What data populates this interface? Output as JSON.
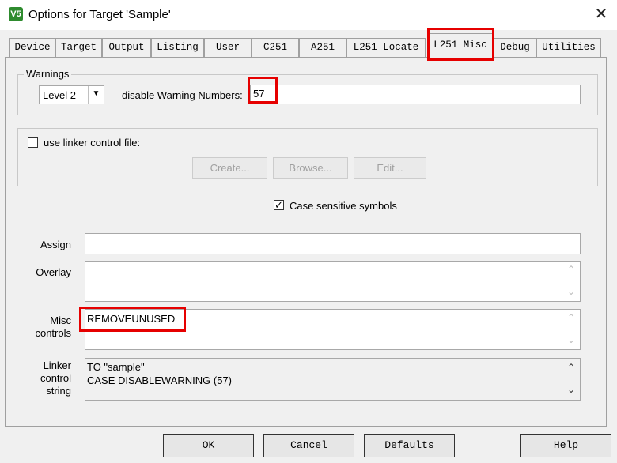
{
  "window": {
    "title": "Options for Target 'Sample'",
    "app_icon_text": "V5",
    "close_glyph": "✕"
  },
  "tabs": [
    {
      "label": "Device"
    },
    {
      "label": "Target"
    },
    {
      "label": "Output"
    },
    {
      "label": "Listing"
    },
    {
      "label": "User"
    },
    {
      "label": "C251"
    },
    {
      "label": "A251"
    },
    {
      "label": "L251 Locate"
    },
    {
      "label": "L251 Misc",
      "active": true
    },
    {
      "label": "Debug"
    },
    {
      "label": "Utilities"
    }
  ],
  "warnings": {
    "group_label": "Warnings",
    "level_value": "Level 2",
    "disable_label": "disable Warning Numbers:",
    "disable_value": "57"
  },
  "linker_control": {
    "checkbox_label": "use linker control file:",
    "checked": false,
    "buttons": {
      "create": "Create...",
      "browse": "Browse...",
      "edit": "Edit..."
    }
  },
  "case_sensitive": {
    "label": "Case sensitive symbols",
    "checked": true
  },
  "fields": {
    "assign_label": "Assign",
    "assign_value": "",
    "overlay_label": "Overlay",
    "overlay_value": "",
    "misc_label_1": "Misc",
    "misc_label_2": "controls",
    "misc_value": "REMOVEUNUSED",
    "linker_label_1": "Linker",
    "linker_label_2": "control",
    "linker_label_3": "string",
    "linker_lines": [
      "TO \"sample\"",
      "CASE DISABLEWARNING (57)"
    ]
  },
  "footer": {
    "ok": "OK",
    "cancel": "Cancel",
    "defaults": "Defaults",
    "help": "Help"
  },
  "icons": {
    "scroll_up": "⌃",
    "scroll_down": "⌄",
    "combo_down": "▼",
    "check": "✓"
  },
  "colors": {
    "highlight": "#e60000",
    "dialog_bg": "#f0f0f0"
  }
}
